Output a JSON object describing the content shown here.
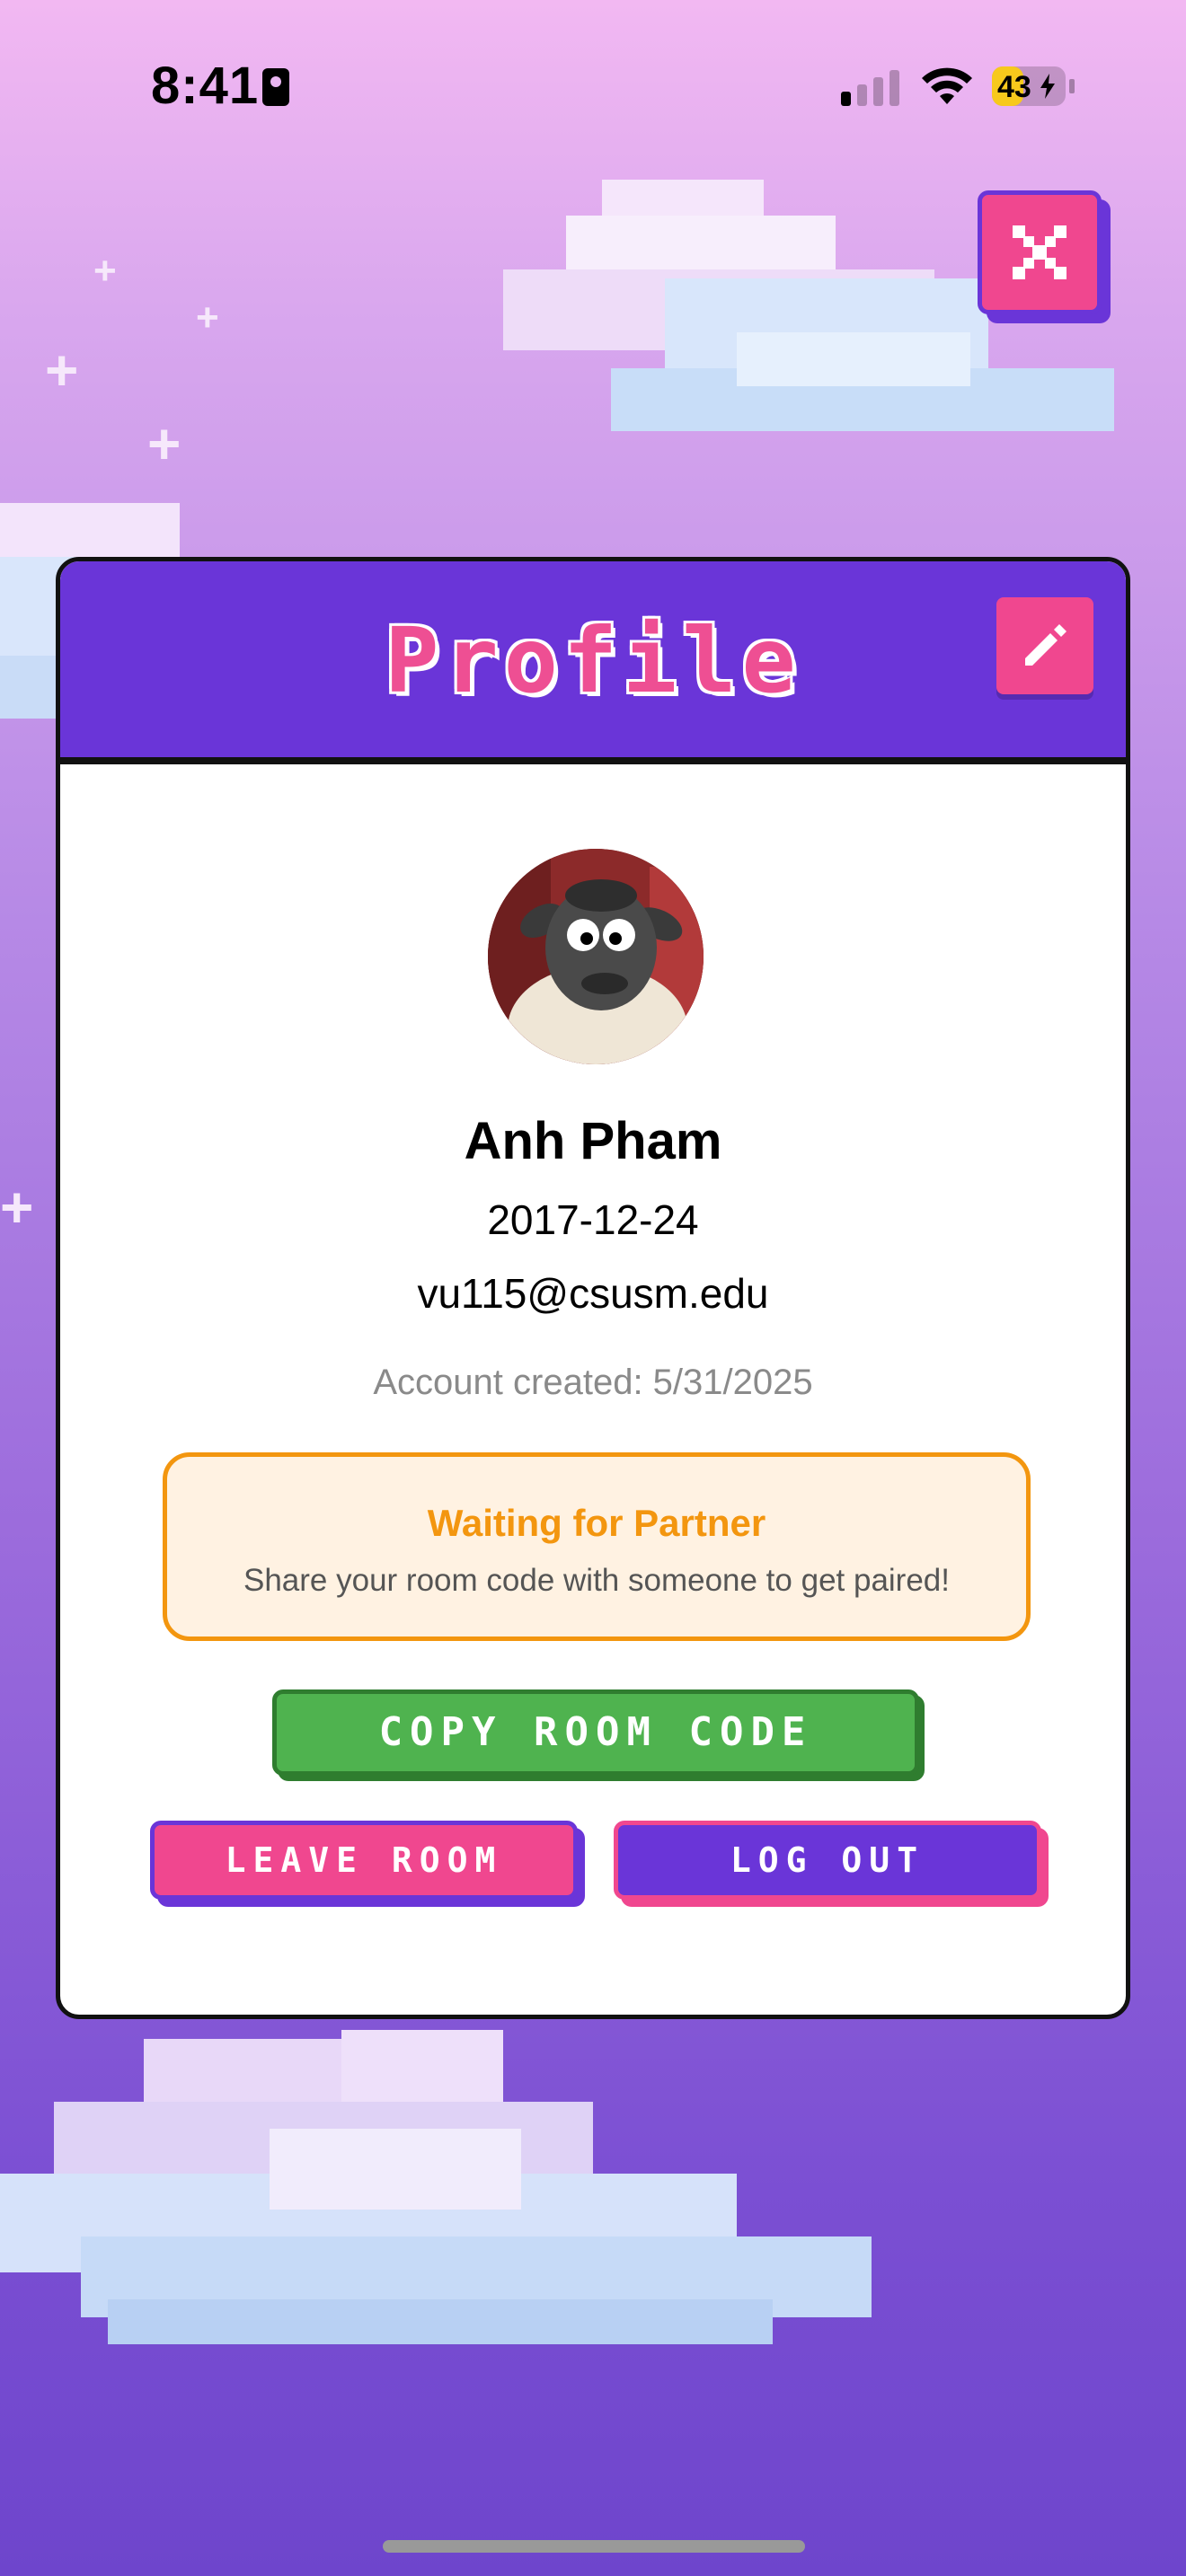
{
  "status_bar": {
    "time": "8:41",
    "battery": "43"
  },
  "profile": {
    "title": "Profile",
    "name": "Anh Pham",
    "birthdate": "2017-12-24",
    "email": "vu115@csusm.edu",
    "account_created": "Account created: 5/31/2025"
  },
  "pairing": {
    "title": "Waiting for Partner",
    "message": "Share your room code with someone to get paired!"
  },
  "actions": {
    "copy_room_code": "COPY ROOM CODE",
    "leave_room": "LEAVE ROOM",
    "log_out": "LOG OUT"
  },
  "colors": {
    "purple": "#6a35d8",
    "pink": "#f0478f",
    "green": "#4fb34f",
    "orange": "#f3960f"
  },
  "icons": {
    "close": "close-icon",
    "edit": "pencil-icon"
  }
}
